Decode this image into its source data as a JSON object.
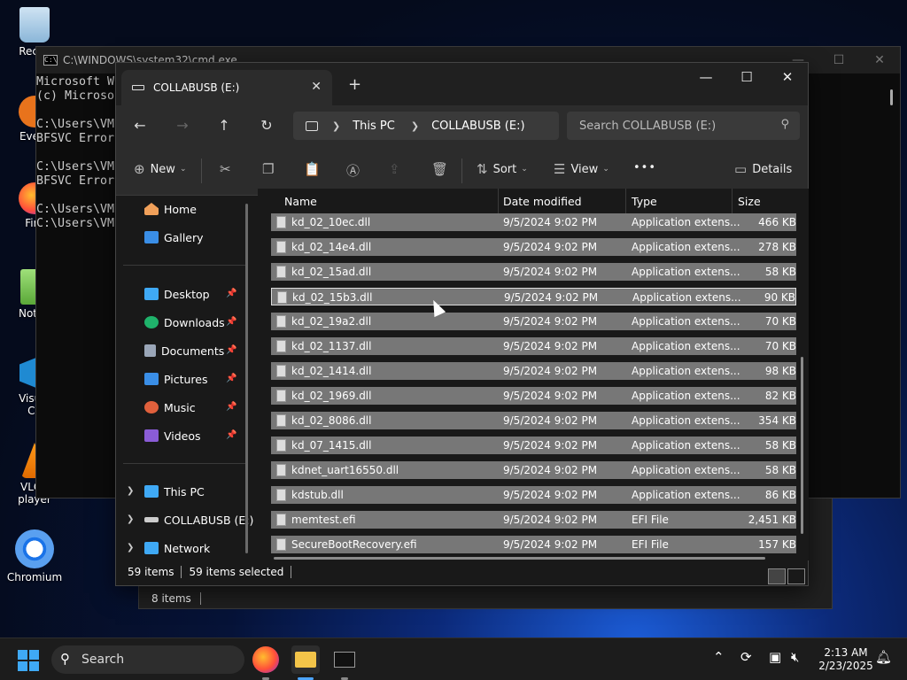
{
  "desktop": {
    "icons": [
      {
        "label": "Recyc",
        "icon": "recycle-bin-icon"
      },
      {
        "label": "Every",
        "icon": "everything-icon"
      },
      {
        "label": "Fire",
        "icon": "firefox-icon"
      },
      {
        "label": "Notep",
        "icon": "notepad-icon"
      },
      {
        "label": "Visual",
        "label2": "Co",
        "icon": "vscode-icon"
      },
      {
        "label": "VLC r",
        "label2": "player",
        "icon": "vlc-icon"
      },
      {
        "label": "Chromium",
        "icon": "chromium-icon"
      }
    ]
  },
  "cmd": {
    "title": "C:\\WINDOWS\\system32\\cmd.exe",
    "lines": [
      "Microsoft Wi",
      "(c) Microso",
      "",
      "C:\\Users\\VM(",
      "BFSVC Error",
      "",
      "C:\\Users\\VM(",
      "BFSVC Error",
      "",
      "C:\\Users\\VM(",
      "C:\\Users\\VM("
    ]
  },
  "explorer": {
    "tab_title": "COLLABUSB (E:)",
    "new_tab": "+",
    "breadcrumb": [
      "This PC",
      "COLLABUSB (E:)"
    ],
    "search_placeholder": "Search COLLABUSB (E:)",
    "toolbar": {
      "new": "New",
      "sort": "Sort",
      "view": "View",
      "more": "•••",
      "details": "Details"
    },
    "sidebar": {
      "top": [
        {
          "label": "Home",
          "icon": "home-icon",
          "color": "#f0a05a"
        },
        {
          "label": "Gallery",
          "icon": "gallery-icon",
          "color": "#3a8ee6"
        }
      ],
      "pinned": [
        {
          "label": "Desktop",
          "icon": "desktop-folder-icon",
          "color": "#3fa9f5"
        },
        {
          "label": "Downloads",
          "icon": "downloads-icon",
          "color": "#1fb36b"
        },
        {
          "label": "Documents",
          "icon": "documents-icon",
          "color": "#9aa6b8"
        },
        {
          "label": "Pictures",
          "icon": "pictures-icon",
          "color": "#3a8ee6"
        },
        {
          "label": "Music",
          "icon": "music-icon",
          "color": "#e0603c"
        },
        {
          "label": "Videos",
          "icon": "videos-icon",
          "color": "#8a5cd6"
        }
      ],
      "tree": [
        {
          "label": "This PC",
          "icon": "this-pc-icon",
          "color": "#3fa9f5"
        },
        {
          "label": "COLLABUSB (E:)",
          "icon": "usb-drive-icon",
          "color": "#cccccc"
        },
        {
          "label": "Network",
          "icon": "network-icon",
          "color": "#3fa9f5"
        }
      ]
    },
    "columns": [
      "Name",
      "Date modified",
      "Type",
      "Size"
    ],
    "files": [
      {
        "name": "kd_02_10ec.dll",
        "date": "9/5/2024 9:02 PM",
        "type": "Application extens...",
        "size": "466 KB"
      },
      {
        "name": "kd_02_14e4.dll",
        "date": "9/5/2024 9:02 PM",
        "type": "Application extens...",
        "size": "278 KB"
      },
      {
        "name": "kd_02_15ad.dll",
        "date": "9/5/2024 9:02 PM",
        "type": "Application extens...",
        "size": "58 KB"
      },
      {
        "name": "kd_02_15b3.dll",
        "date": "9/5/2024 9:02 PM",
        "type": "Application extens...",
        "size": "90 KB"
      },
      {
        "name": "kd_02_19a2.dll",
        "date": "9/5/2024 9:02 PM",
        "type": "Application extens...",
        "size": "70 KB"
      },
      {
        "name": "kd_02_1137.dll",
        "date": "9/5/2024 9:02 PM",
        "type": "Application extens...",
        "size": "70 KB"
      },
      {
        "name": "kd_02_1414.dll",
        "date": "9/5/2024 9:02 PM",
        "type": "Application extens...",
        "size": "98 KB"
      },
      {
        "name": "kd_02_1969.dll",
        "date": "9/5/2024 9:02 PM",
        "type": "Application extens...",
        "size": "82 KB"
      },
      {
        "name": "kd_02_8086.dll",
        "date": "9/5/2024 9:02 PM",
        "type": "Application extens...",
        "size": "354 KB"
      },
      {
        "name": "kd_07_1415.dll",
        "date": "9/5/2024 9:02 PM",
        "type": "Application extens...",
        "size": "58 KB"
      },
      {
        "name": "kdnet_uart16550.dll",
        "date": "9/5/2024 9:02 PM",
        "type": "Application extens...",
        "size": "58 KB"
      },
      {
        "name": "kdstub.dll",
        "date": "9/5/2024 9:02 PM",
        "type": "Application extens...",
        "size": "86 KB"
      },
      {
        "name": "memtest.efi",
        "date": "9/5/2024 9:02 PM",
        "type": "EFI File",
        "size": "2,451 KB"
      },
      {
        "name": "SecureBootRecovery.efi",
        "date": "9/5/2024 9:02 PM",
        "type": "EFI File",
        "size": "157 KB"
      }
    ],
    "status": {
      "count": "59 items",
      "selected": "59 items selected"
    }
  },
  "explorer2": {
    "status": "8 items"
  },
  "taskbar": {
    "search_label": "Search",
    "time": "2:13 AM",
    "date": "2/23/2025"
  },
  "colors": {
    "accent": "#0078d4",
    "selection": "#777777"
  }
}
